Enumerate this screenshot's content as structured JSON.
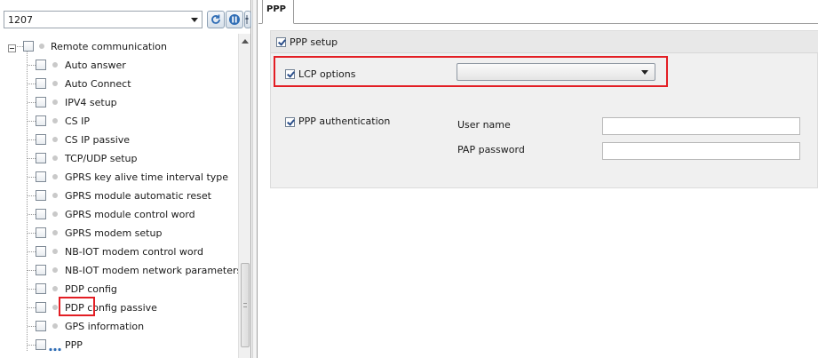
{
  "left_panel": {
    "combo_value": "1207",
    "toolbar": [
      "refresh-icon",
      "info-icon",
      "settings-sliders-icon"
    ],
    "tree": {
      "root_label": "Remote communication",
      "items": [
        {
          "label": "Auto answer"
        },
        {
          "label": "Auto Connect"
        },
        {
          "label": "IPV4 setup"
        },
        {
          "label": "CS IP"
        },
        {
          "label": "CS IP passive"
        },
        {
          "label": "TCP/UDP setup"
        },
        {
          "label": "GPRS key alive time interval type"
        },
        {
          "label": "GPRS module automatic reset"
        },
        {
          "label": "GPRS module control word"
        },
        {
          "label": "GPRS modem setup"
        },
        {
          "label": "NB-IOT modem control word"
        },
        {
          "label": "NB-IOT modem network parameters"
        },
        {
          "label": "PDP config"
        },
        {
          "label": "PDP config passive"
        },
        {
          "label": "GPS information"
        },
        {
          "label": "PPP"
        }
      ],
      "selected": "PPP"
    }
  },
  "tabs": [
    {
      "label": "PPP",
      "active": true
    }
  ],
  "ppp_panel": {
    "header_label": "PPP setup",
    "header_checked": true,
    "lcp_label": "LCP options",
    "lcp_checked": true,
    "lcp_value": "",
    "auth_label": "PPP authentication",
    "auth_checked": true,
    "user_name_label": "User name",
    "user_name_value": "",
    "pap_password_label": "PAP password",
    "pap_password_value": ""
  },
  "colors": {
    "highlight": "#e31e24",
    "panel_bg": "#f0f0f0",
    "check_color": "#2a4e8a"
  }
}
